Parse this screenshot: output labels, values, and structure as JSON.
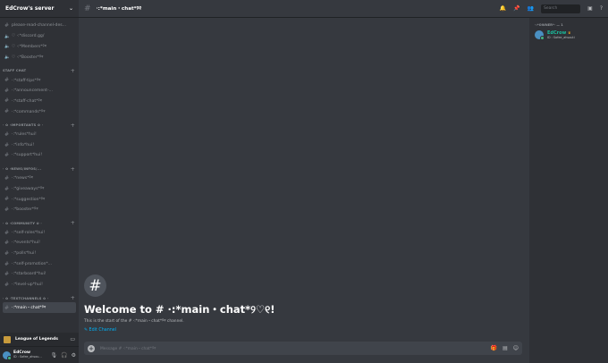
{
  "server": {
    "name": "EdCrow's server"
  },
  "sidebar": {
    "top_channels": [
      {
        "type": "text",
        "label": "please-read-channel-des..."
      },
      {
        "type": "voice",
        "label": "♡ ·:*discord.gg/"
      },
      {
        "type": "voice",
        "label": "♡ ·:*Members*୨୧"
      },
      {
        "type": "voice",
        "label": "♡ ·:*Booster*୨୧"
      }
    ],
    "categories": [
      {
        "name": "STAFF CHAT",
        "channels": [
          "·:*staff-tips*୨୧",
          "·:*announcement-...",
          "·:*staff-chat*୨୧",
          "·:*commands*୨୧"
        ]
      },
      {
        "name": "· ✿ ·IMPORTANTS ✿ ·",
        "channels": [
          "·:*rules*hui!",
          "·:*info*hui!",
          "·:*support*hui!"
        ]
      },
      {
        "name": "· ✿ ·NEWS/INFOS/...",
        "channels": [
          "·:*news*୨୧",
          "·:*giveaways*୨୧",
          "·:*suggestion*୨୧",
          "·:*booster*୨୧"
        ]
      },
      {
        "name": "· ✿ ·COMMUNITY ✿ ·",
        "channels": [
          "·:*self-roles*hui!",
          "·:*events*hui!",
          "·:*polls*hui!",
          "·:*self-promotion*...",
          "·:*starboard*hui!",
          "·:*level-up*hui!"
        ]
      },
      {
        "name": "· ✿ ·TEXTCHANNELS ✿ ·",
        "channels": [
          "·:*main・chat*୨୧"
        ]
      }
    ],
    "active_channel": "·:*main・chat*୨୧"
  },
  "activity": {
    "label": "League of Legends"
  },
  "user": {
    "name": "EdCrow",
    "status": "ID : Safee_ahsou..."
  },
  "topbar": {
    "channel": "·:*main・chat*୨୧",
    "search_placeholder": "Search"
  },
  "welcome": {
    "title": "Welcome to # ·:*main・chat*୨♡୧!",
    "subtitle": "This is the start of the # ·:*main・chat*୨୧ channel.",
    "edit_label": "Edit Channel"
  },
  "composer": {
    "placeholder": "Message # ·:*main・chat*୨୧"
  },
  "members": {
    "category": "·:*OWNER*· — 1",
    "list": [
      {
        "name": "EdCrow",
        "status": "ID : Safee_ahsouti"
      }
    ]
  },
  "colors": {
    "accent": "#00b0f4",
    "online": "#43b581",
    "owner_name": "#1abc9c"
  }
}
